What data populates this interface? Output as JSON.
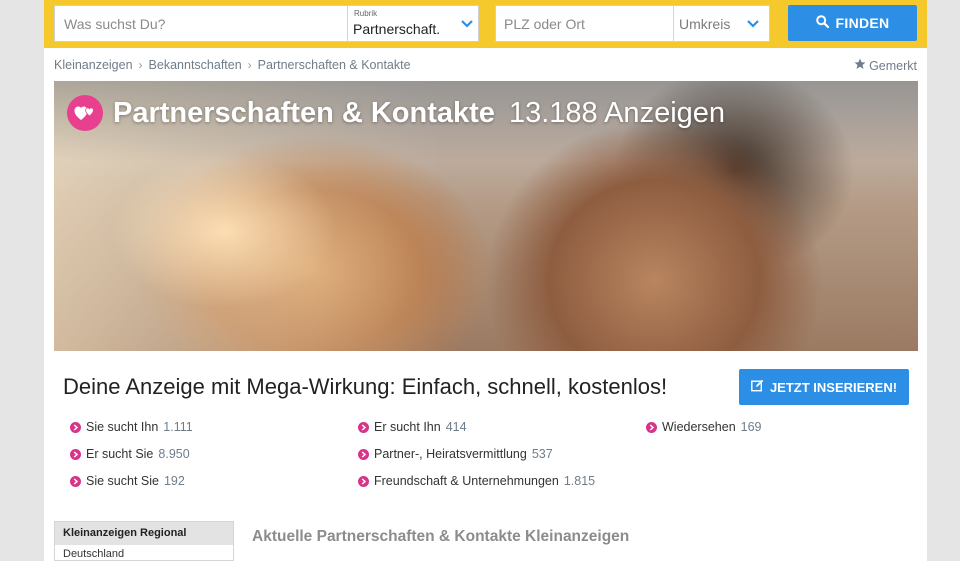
{
  "search": {
    "placeholder": "Was suchst Du?",
    "rubrik_label": "Rubrik",
    "rubrik_value": "Partnerschaft.",
    "location_placeholder": "PLZ oder Ort",
    "radius_value": "Umkreis",
    "find_label": "FINDEN"
  },
  "breadcrumb": [
    "Kleinanzeigen",
    "Bekanntschaften",
    "Partnerschaften & Kontakte"
  ],
  "bookmark_label": "Gemerkt",
  "hero": {
    "title": "Partnerschaften & Kontakte",
    "count": "13.188 Anzeigen"
  },
  "promo": {
    "text": "Deine Anzeige mit Mega-Wirkung: Einfach, schnell, kostenlos!",
    "button_label": "JETZT INSERIEREN!"
  },
  "categories": [
    {
      "label": "Sie sucht Ihn",
      "count": "1.111"
    },
    {
      "label": "Er sucht Sie",
      "count": "8.950"
    },
    {
      "label": "Sie sucht Sie",
      "count": "192"
    },
    {
      "label": "Er sucht Ihn",
      "count": "414"
    },
    {
      "label": "Partner-, Heiratsvermittlung",
      "count": "537"
    },
    {
      "label": "Freundschaft & Unternehmungen",
      "count": "1.815"
    },
    {
      "label": "Wiedersehen",
      "count": "169"
    }
  ],
  "sidebar": {
    "heading": "Kleinanzeigen Regional",
    "first_item": "Deutschland"
  },
  "listing_heading": "Aktuelle Partnerschaften & Kontakte Kleinanzeigen",
  "colors": {
    "topbar": "#f5c92c",
    "button_blue": "#2d8ee5",
    "accent_pink": "#d9338a"
  }
}
